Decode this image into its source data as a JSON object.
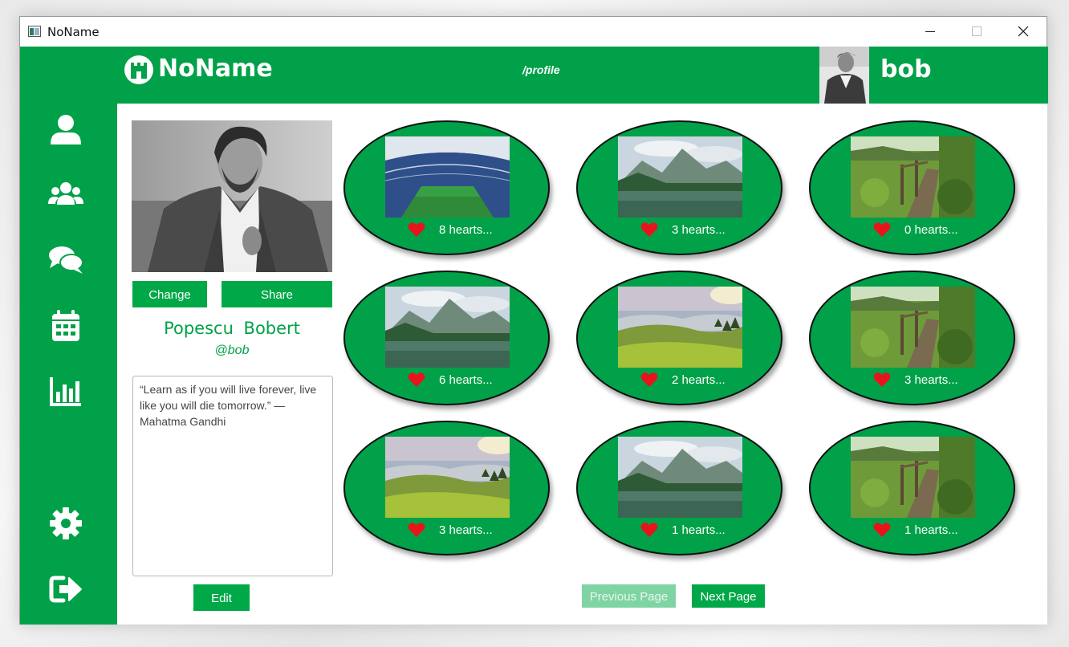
{
  "window": {
    "title": "NoName"
  },
  "header": {
    "app_name": "NoName",
    "route": "/profile",
    "username": "bob"
  },
  "sidebar": {
    "items": [
      {
        "icon": "user-icon"
      },
      {
        "icon": "users-icon"
      },
      {
        "icon": "chat-icon"
      },
      {
        "icon": "calendar-icon"
      },
      {
        "icon": "chart-icon"
      },
      {
        "icon": "gear-icon"
      },
      {
        "icon": "logout-icon"
      }
    ]
  },
  "profile": {
    "change_label": "Change",
    "share_label": "Share",
    "full_name": "Popescu  Bobert",
    "handle": "@bob",
    "bio": "“Learn as if you will live forever, live like you will die tomorrow.” — Mahatma Gandhi",
    "edit_label": "Edit"
  },
  "posts": [
    {
      "image": "stadium",
      "hearts": "8 hearts..."
    },
    {
      "image": "mountain-lake",
      "hearts": "3 hearts..."
    },
    {
      "image": "wooden-path",
      "hearts": "0 hearts..."
    },
    {
      "image": "mountain-lake",
      "hearts": "6 hearts..."
    },
    {
      "image": "misty-hills",
      "hearts": "2 hearts..."
    },
    {
      "image": "wooden-path",
      "hearts": "3 hearts..."
    },
    {
      "image": "misty-hills",
      "hearts": "3 hearts..."
    },
    {
      "image": "mountain-lake",
      "hearts": "1 hearts..."
    },
    {
      "image": "wooden-path",
      "hearts": "1 hearts..."
    }
  ],
  "pagination": {
    "prev_label": "Previous Page",
    "next_label": "Next Page"
  },
  "colors": {
    "brand_green": "#00a148",
    "button_green": "#00a848",
    "disabled_green": "#7fd4a3",
    "heart_red": "#e8141c"
  }
}
